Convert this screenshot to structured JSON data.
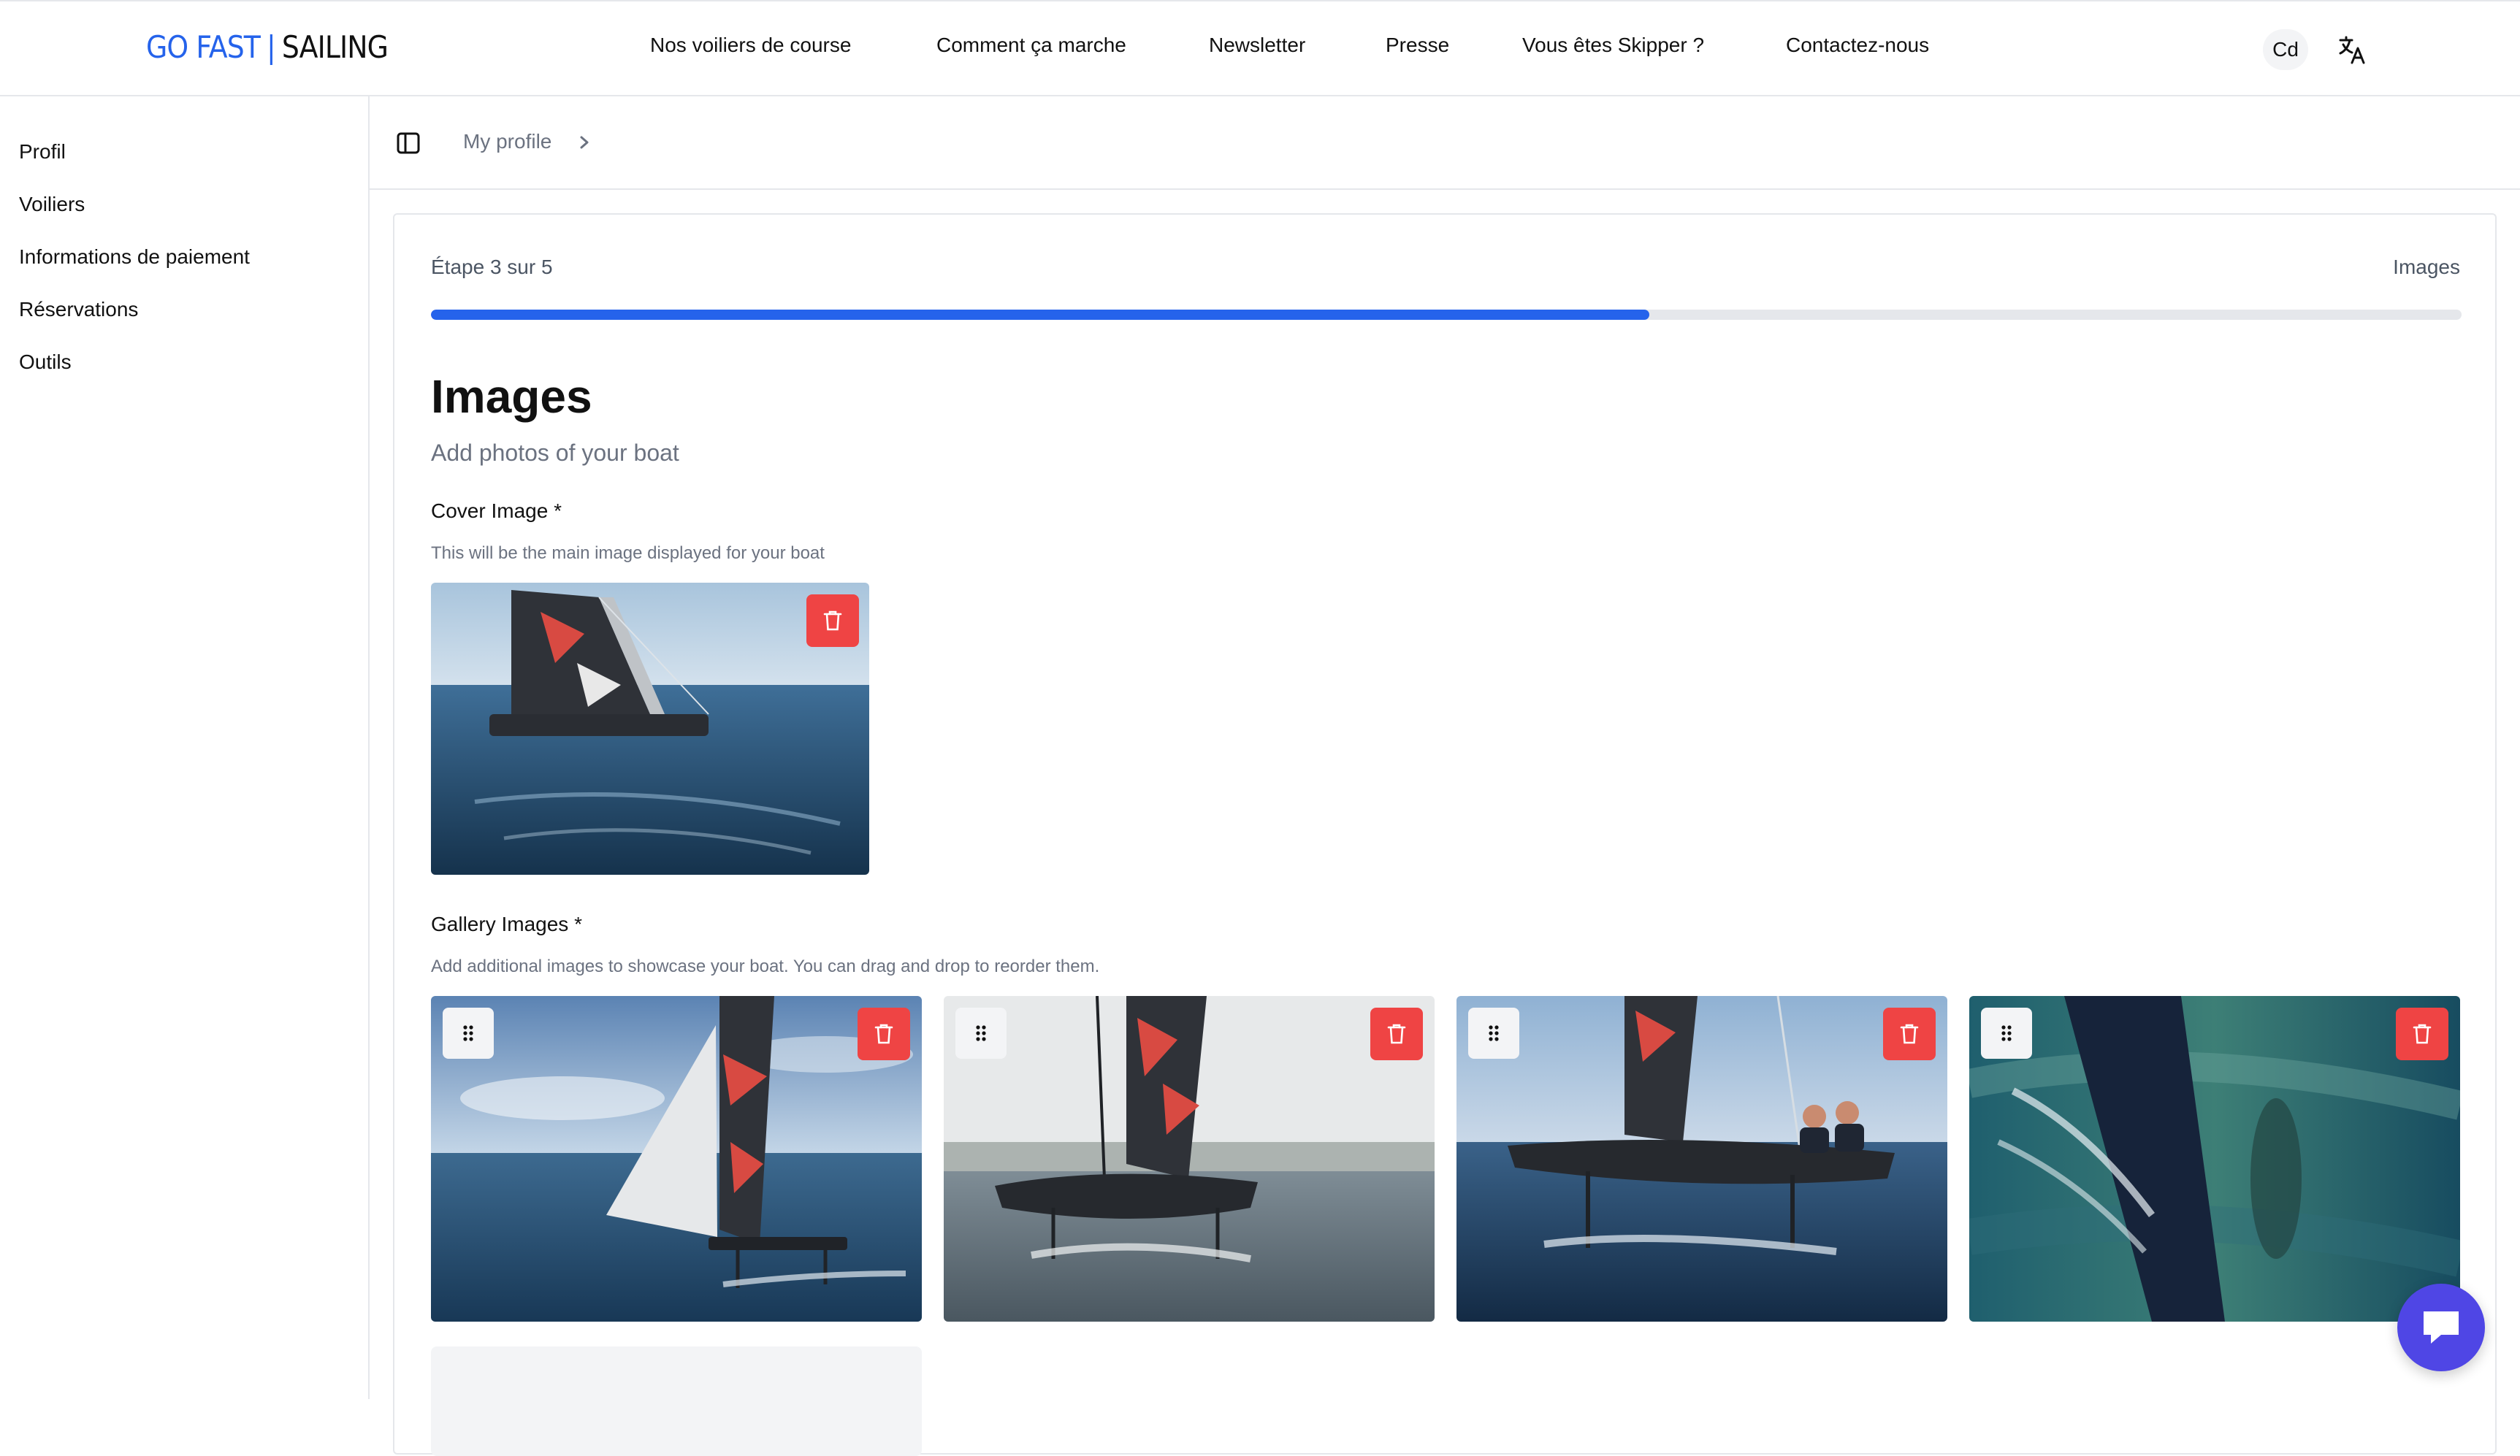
{
  "brand": {
    "part1": "GO FAST",
    "separator": "|",
    "part2": "SAILING",
    "color": "#2563eb"
  },
  "nav": {
    "items": [
      "Nos voiliers de course",
      "Comment ça marche",
      "Newsletter",
      "Presse",
      "Vous êtes Skipper ?",
      "Contactez-nous"
    ],
    "avatar_initials": "Cd",
    "language_icon": "translate-icon"
  },
  "sidebar": {
    "items": [
      "Profil",
      "Voiliers",
      "Informations de paiement",
      "Réservations",
      "Outils"
    ]
  },
  "breadcrumb": {
    "items": [
      "My profile"
    ]
  },
  "wizard": {
    "step_text": "Étape 3 sur 5",
    "step_name": "Images",
    "progress_fraction": 0.6,
    "title": "Images",
    "subtitle": "Add photos of your boat"
  },
  "cover": {
    "label": "Cover Image *",
    "hint": "This will be the main image displayed for your boat"
  },
  "gallery": {
    "label": "Gallery Images *",
    "hint": "Add additional images to showcase your boat. You can drag and drop to reorder them.",
    "count": 4
  },
  "colors": {
    "accent": "#2563eb",
    "danger": "#ef4444",
    "chat": "#4f46e5"
  }
}
